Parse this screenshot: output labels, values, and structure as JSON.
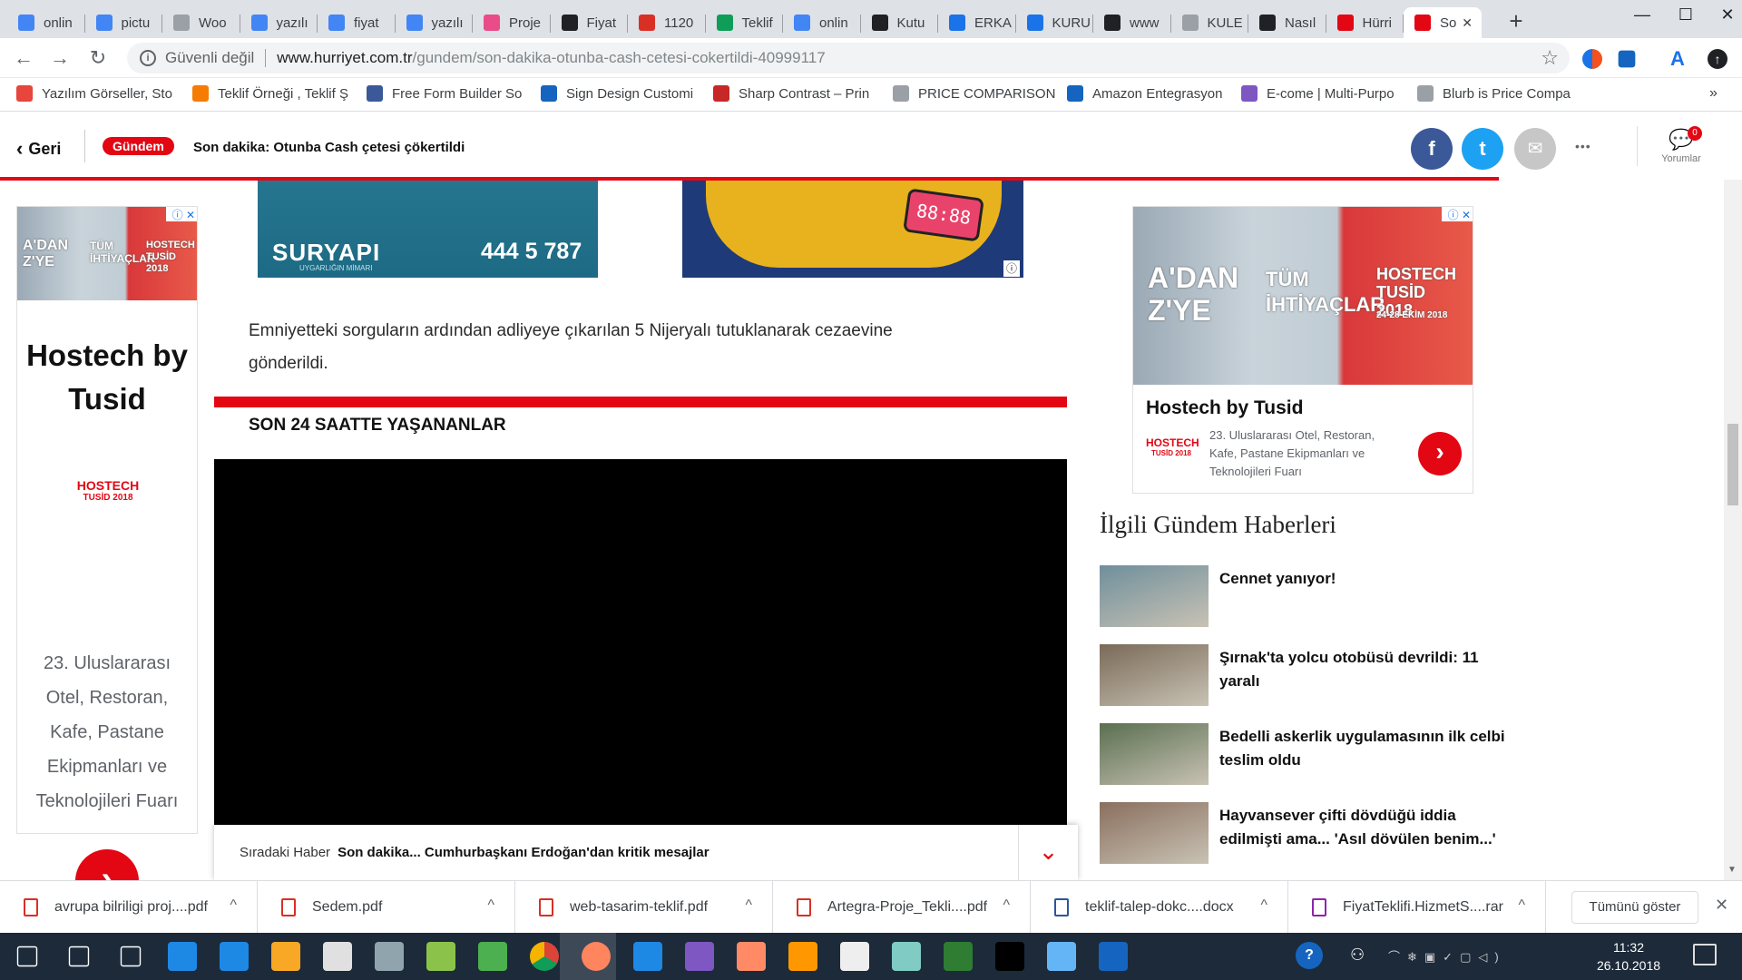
{
  "browser": {
    "tabs": [
      {
        "label": "onlin",
        "icon": "google-icon",
        "color": "#4285f4"
      },
      {
        "label": "pictu",
        "icon": "google-icon",
        "color": "#4285f4"
      },
      {
        "label": "Woo",
        "icon": "page-icon",
        "color": "#9aa0a6"
      },
      {
        "label": "yazılı",
        "icon": "google-icon",
        "color": "#4285f4"
      },
      {
        "label": "fiyat",
        "icon": "google-icon",
        "color": "#4285f4"
      },
      {
        "label": "yazılı",
        "icon": "google-icon",
        "color": "#4285f4"
      },
      {
        "label": "Proje",
        "icon": "dribbble-icon",
        "color": "#ea4c89"
      },
      {
        "label": "Fiyat",
        "icon": "symfony-icon",
        "color": "#202124"
      },
      {
        "label": "1120",
        "icon": "gmail-icon",
        "color": "#d93025"
      },
      {
        "label": "Teklif",
        "icon": "sheets-icon",
        "color": "#0f9d58"
      },
      {
        "label": "onlin",
        "icon": "google-icon",
        "color": "#4285f4"
      },
      {
        "label": "Kutu",
        "icon": "link-icon",
        "color": "#202124"
      },
      {
        "label": "ERKA",
        "icon": "erka-icon",
        "color": "#1a73e8"
      },
      {
        "label": "KURU",
        "icon": "play-icon",
        "color": "#1a73e8"
      },
      {
        "label": "www",
        "icon": "link-icon",
        "color": "#202124"
      },
      {
        "label": "KULE",
        "icon": "page-icon",
        "color": "#9aa0a6"
      },
      {
        "label": "Nasıl",
        "icon": "ak-icon",
        "color": "#202124"
      },
      {
        "label": "Hürri",
        "icon": "hurriyet-icon",
        "color": "#e30613"
      },
      {
        "label": "So",
        "icon": "hurriyet-icon",
        "color": "#e30613"
      }
    ],
    "new_tab": "+",
    "window_controls": {
      "minimize": "—",
      "maximize": "☐",
      "close": "✕"
    },
    "security": "Güvenli değil",
    "url_host": "www.hurriyet.com.tr",
    "url_path": "/gundem/son-dakika-otunba-cash-cetesi-cokertildi-40999117",
    "bookmarks": [
      {
        "label": "Yazılım Görseller, Sto",
        "color": "#e8453c"
      },
      {
        "label": "Teklif Örneği , Teklif Ş",
        "color": "#f57c00"
      },
      {
        "label": "Free Form Builder So",
        "color": "#3b5998"
      },
      {
        "label": "Sign Design Customi",
        "color": "#1565c0"
      },
      {
        "label": "Sharp Contrast – Prin",
        "color": "#c62828"
      },
      {
        "label": "PRICE COMPARISON",
        "color": "#9aa0a6"
      },
      {
        "label": "Amazon Entegrasyon",
        "color": "#1565c0"
      },
      {
        "label": "E-come | Multi-Purpo",
        "color": "#7e57c2"
      },
      {
        "label": "Blurb is Price Compa",
        "color": "#9aa0a6"
      }
    ],
    "bookmarks_more": "»"
  },
  "header": {
    "back_label": "Geri",
    "category_badge": "Gündem",
    "headline": "Son dakika: Otunba Cash çetesi çökertildi",
    "share": {
      "facebook": "f",
      "twitter": "t",
      "email": "✉",
      "more": "•••"
    },
    "comments_label": "Yorumlar",
    "comments_count": "0"
  },
  "ads": {
    "top_left": {
      "brand": "SURYAPI",
      "sub": "UYGARLIĞIN MİMARI",
      "phone": "444 5 787"
    },
    "top_right": {
      "clock": "88:88"
    },
    "left": {
      "title": "Hostech by Tusid",
      "logo_line1": "HOSTECH",
      "logo_line2": "TUSİD 2018",
      "text": "23. Uluslararası Otel, Restoran, Kafe, Pastane Ekipmanları ve Teknolojileri Fuarı",
      "banner_a": "A'DAN Z'YE",
      "banner_b": "TÜM İHTİYAÇLAR",
      "banner_logo": "HOSTECH TUSİD 2018"
    },
    "right": {
      "title": "Hostech by Tusid",
      "logo_line1": "HOSTECH",
      "logo_line2": "TUSİD 2018",
      "text": "23. Uluslararası Otel, Restoran, Kafe, Pastane Ekipmanları ve Teknolojileri Fuarı",
      "banner_a": "A'DAN Z'YE",
      "banner_b": "TÜM İHTİYAÇLAR",
      "banner_logo": "HOSTECH TUSİD 2018",
      "banner_date": "24-28 EKİM 2018"
    }
  },
  "article": {
    "paragraph": "Emniyetteki sorguların ardından adliyeye çıkarılan 5 Nijeryalı tutuklanarak cezaevine gönderildi.",
    "section_title": "SON 24 SAATTE YAŞANANLAR"
  },
  "next_news": {
    "label": "Sıradaki Haber",
    "title": "Son dakika... Cumhurbaşkanı Erdoğan'dan kritik mesajlar"
  },
  "related": {
    "heading": "İlgili Gündem Haberleri",
    "items": [
      {
        "title": "Cennet yanıyor!",
        "thumb": "#6f8f9c"
      },
      {
        "title": "Şırnak'ta yolcu otobüsü devrildi: 11 yaralı",
        "thumb": "#7a6a58"
      },
      {
        "title": "Bedelli askerlik uygulamasının ilk celbi teslim oldu",
        "thumb": "#5a6f50"
      },
      {
        "title": "Hayvansever çifti dövdüğü iddia edilmişti ama... 'Asıl dövülen benim...'",
        "thumb": "#8a6f5e"
      }
    ]
  },
  "downloads": {
    "items": [
      {
        "name": "avrupa bilriligi proj....pdf",
        "type": "pdf"
      },
      {
        "name": "Sedem.pdf",
        "type": "pdf"
      },
      {
        "name": "web-tasarim-teklif.pdf",
        "type": "pdf"
      },
      {
        "name": "Artegra-Proje_Tekli....pdf",
        "type": "pdf"
      },
      {
        "name": "teklif-talep-dokc....docx",
        "type": "docx"
      },
      {
        "name": "FiyatTeklifi.HizmetS....rar",
        "type": "rar"
      }
    ],
    "show_all": "Tümünü göster"
  },
  "taskbar": {
    "time": "11:32",
    "date": "26.10.2018",
    "icons": [
      "windows-start-icon",
      "search-icon",
      "task-view-icon",
      "skype-icon",
      "edge-icon",
      "file-explorer-icon",
      "store-icon",
      "mail-icon",
      "outlook-icon",
      "excel-icon",
      "chrome-icon",
      "firefox-icon",
      "bluestacks-icon",
      "visual-studio-icon",
      "paint-icon",
      "game-icon",
      "calculator-icon",
      "notepad-icon",
      "excel-icon",
      "cmd-icon",
      "photo-icon",
      "word-icon"
    ]
  }
}
